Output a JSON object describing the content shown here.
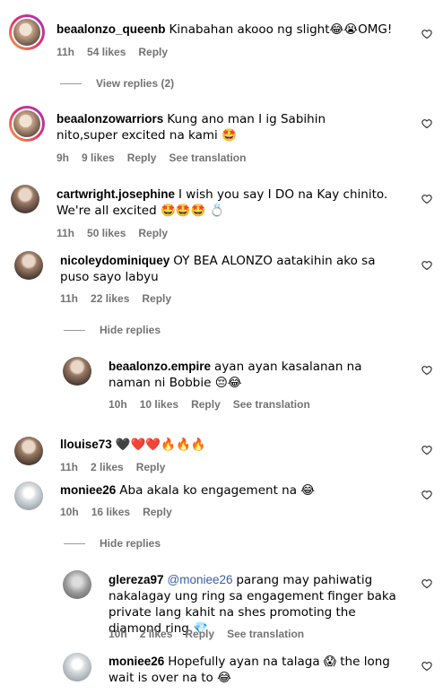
{
  "comments": [
    {
      "user": "beaalonzo_queenb",
      "text": "Kinabahan akooo ng slight😂😭OMG!",
      "time": "11h",
      "likes": "54 likes",
      "reply": "Reply"
    },
    {
      "user": "beaalonzowarriors",
      "text": "Kung ano man I ig Sabihin nito,super excited na kami 🤩",
      "time": "9h",
      "likes": "9 likes",
      "reply": "Reply",
      "translate": "See translation"
    },
    {
      "user": "cartwright.josephine",
      "text": "I wish you say I DO na Kay chinito. We're all excited 🤩🤩🤩 💍",
      "time": "11h",
      "likes": "50 likes",
      "reply": "Reply"
    },
    {
      "user": "nicoleydominiquey",
      "text": "OY BEA ALONZO aatakihin ako sa puso sayo labyu",
      "time": "11h",
      "likes": "22 likes",
      "reply": "Reply"
    },
    {
      "user": "beaalonzo.empire",
      "text": "ayan ayan kasalanan na naman ni Bobbie 😔😂",
      "time": "10h",
      "likes": "10 likes",
      "reply": "Reply",
      "translate": "See translation"
    },
    {
      "user": "llouise73",
      "text": "🖤❤️❤️🔥🔥🔥",
      "time": "11h",
      "likes": "2 likes",
      "reply": "Reply"
    },
    {
      "user": "moniee26",
      "text": "Aba akala ko engagement na 😂",
      "time": "10h",
      "likes": "16 likes",
      "reply": "Reply"
    },
    {
      "user": "glereza97",
      "mention": "@moniee26",
      "text": "parang may pahiwatig nakalagay ung ring sa engagement finger baka private lang kahit na shes promoting the diamond ring 💎",
      "time": "10h",
      "likes": "2 likes",
      "reply": "Reply",
      "translate": "See translation"
    },
    {
      "user": "moniee26",
      "text": "Hopefully ayan na talaga 😱 the long wait is over na to 😂"
    }
  ],
  "toggles": {
    "view_replies": "View replies (2)",
    "hide_replies_1": "Hide replies",
    "hide_replies_2": "Hide replies"
  },
  "icons": {
    "like": "heart-outline-icon"
  }
}
